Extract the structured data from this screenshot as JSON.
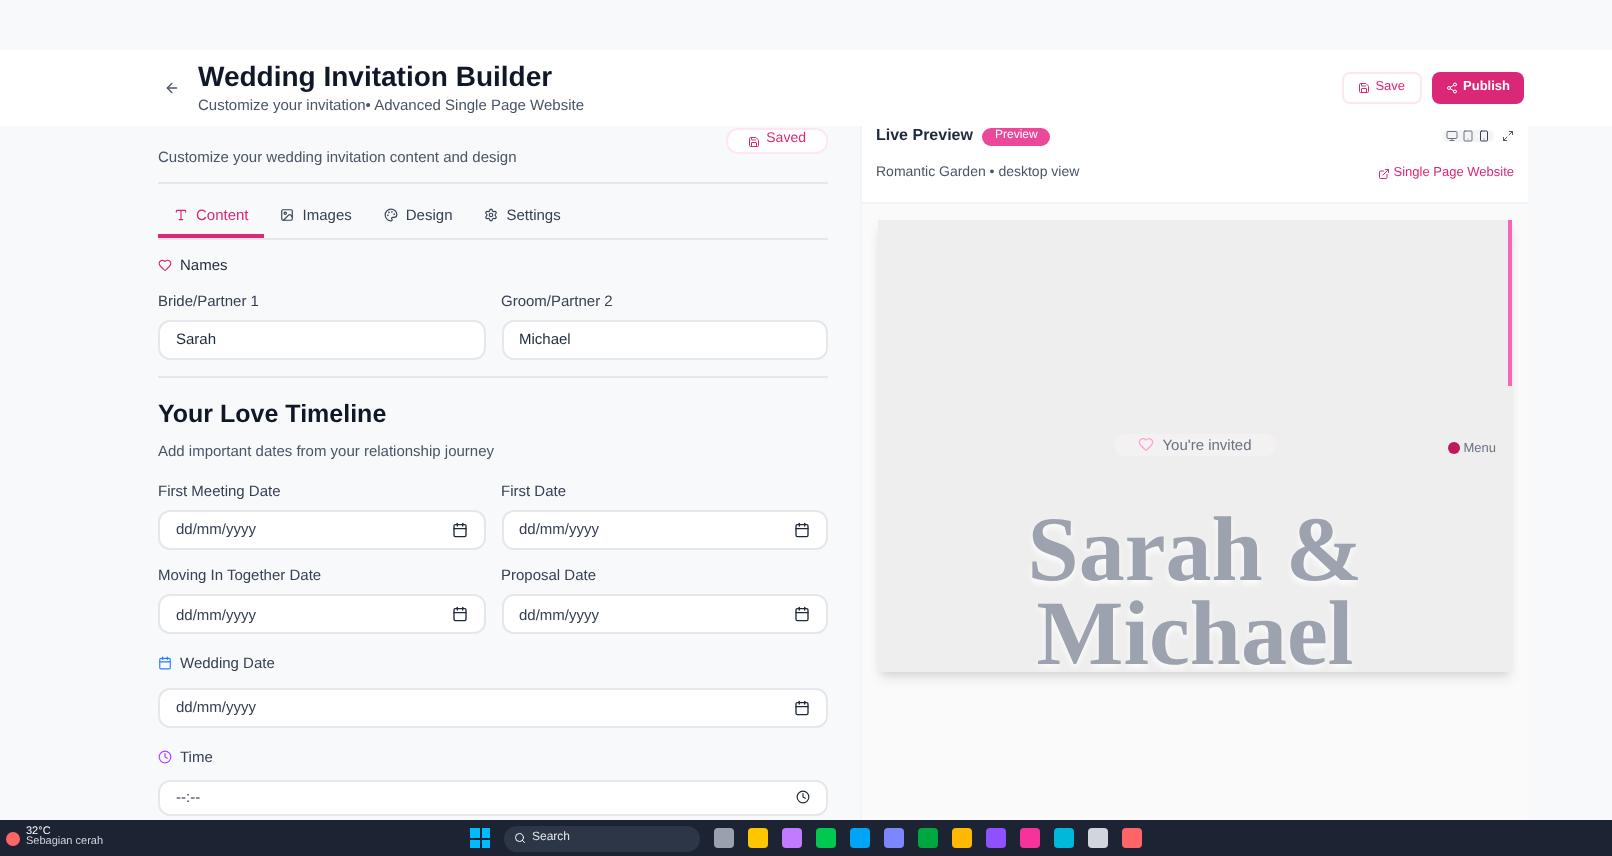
{
  "header": {
    "title": "Wedding Invitation Builder",
    "subtitle": "Customize your invitation• Advanced Single Page Website",
    "buttons": [
      {
        "label": "Save",
        "kind": "outline"
      },
      {
        "label": "Publish",
        "kind": "primary"
      }
    ]
  },
  "editor": {
    "save_status": "Saved",
    "description": "Customize your wedding invitation content and design",
    "tabs": [
      {
        "label": "Content",
        "selected": true
      },
      {
        "label": "Images",
        "selected": false
      },
      {
        "label": "Design",
        "selected": false
      },
      {
        "label": "Settings",
        "selected": false
      }
    ],
    "names": {
      "title": "Names",
      "fields": [
        {
          "label": "Bride/Partner 1",
          "value": "Sarah"
        },
        {
          "label": "Groom/Partner 2",
          "value": "Michael"
        }
      ]
    },
    "timeline": {
      "title": "Your Love Timeline",
      "subtitle": "Add important dates from your relationship journey",
      "fields": [
        {
          "label": "First Meeting Date",
          "placeholder": "dd/mm/yyyy"
        },
        {
          "label": "First Date",
          "placeholder": "dd/mm/yyyy"
        },
        {
          "label": "Moving In Together Date",
          "placeholder": "dd/mm/yyyy"
        },
        {
          "label": "Proposal Date",
          "placeholder": "dd/mm/yyyy"
        }
      ]
    },
    "wedding_date": {
      "label": "Wedding Date",
      "placeholder": "dd/mm/yyyy"
    },
    "time": {
      "label": "Time",
      "placeholder": "--:--"
    }
  },
  "preview": {
    "title": "Live Preview",
    "badge": "Preview",
    "subtitle": "Romantic Garden • desktop view",
    "link": "Single Page Website",
    "invite_badge": "You're invited",
    "menu": "Menu",
    "hero_title": "Sarah & Michael"
  },
  "taskbar": {
    "temperature": "32°C",
    "weather": "Sebagian cerah",
    "search_placeholder": "Search"
  }
}
